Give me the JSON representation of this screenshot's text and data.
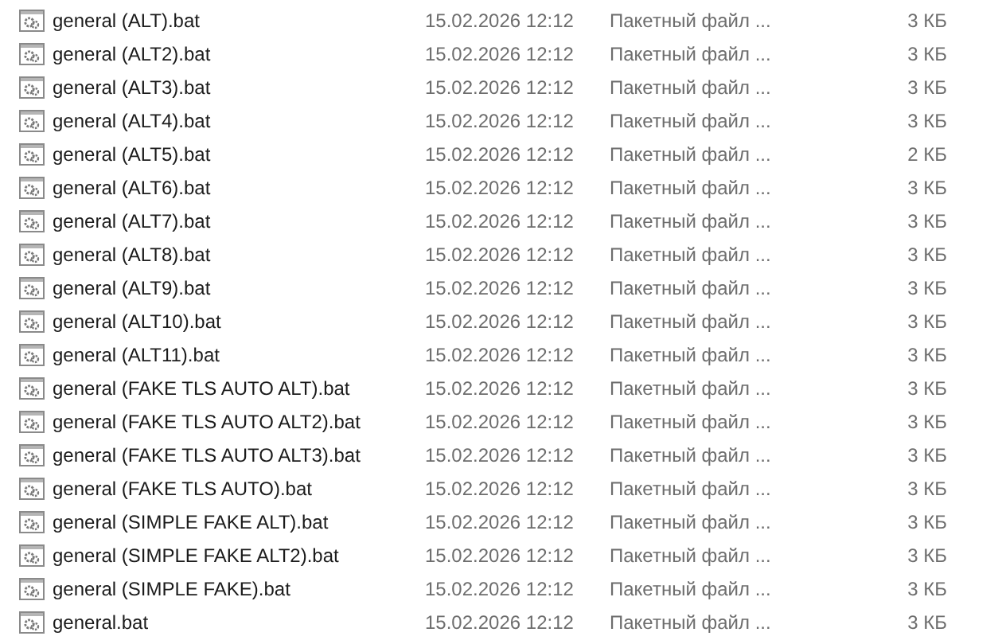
{
  "files": [
    {
      "name": "general (ALT).bat",
      "modified": "15.02.2026 12:12",
      "type": "Пакетный файл ...",
      "size": "3 КБ"
    },
    {
      "name": "general (ALT2).bat",
      "modified": "15.02.2026 12:12",
      "type": "Пакетный файл ...",
      "size": "3 КБ"
    },
    {
      "name": "general (ALT3).bat",
      "modified": "15.02.2026 12:12",
      "type": "Пакетный файл ...",
      "size": "3 КБ"
    },
    {
      "name": "general (ALT4).bat",
      "modified": "15.02.2026 12:12",
      "type": "Пакетный файл ...",
      "size": "3 КБ"
    },
    {
      "name": "general (ALT5).bat",
      "modified": "15.02.2026 12:12",
      "type": "Пакетный файл ...",
      "size": "2 КБ"
    },
    {
      "name": "general (ALT6).bat",
      "modified": "15.02.2026 12:12",
      "type": "Пакетный файл ...",
      "size": "3 КБ"
    },
    {
      "name": "general (ALT7).bat",
      "modified": "15.02.2026 12:12",
      "type": "Пакетный файл ...",
      "size": "3 КБ"
    },
    {
      "name": "general (ALT8).bat",
      "modified": "15.02.2026 12:12",
      "type": "Пакетный файл ...",
      "size": "3 КБ"
    },
    {
      "name": "general (ALT9).bat",
      "modified": "15.02.2026 12:12",
      "type": "Пакетный файл ...",
      "size": "3 КБ"
    },
    {
      "name": "general (ALT10).bat",
      "modified": "15.02.2026 12:12",
      "type": "Пакетный файл ...",
      "size": "3 КБ"
    },
    {
      "name": "general (ALT11).bat",
      "modified": "15.02.2026 12:12",
      "type": "Пакетный файл ...",
      "size": "3 КБ"
    },
    {
      "name": "general (FAKE TLS AUTO ALT).bat",
      "modified": "15.02.2026 12:12",
      "type": "Пакетный файл ...",
      "size": "3 КБ"
    },
    {
      "name": "general (FAKE TLS AUTO ALT2).bat",
      "modified": "15.02.2026 12:12",
      "type": "Пакетный файл ...",
      "size": "3 КБ"
    },
    {
      "name": "general (FAKE TLS AUTO ALT3).bat",
      "modified": "15.02.2026 12:12",
      "type": "Пакетный файл ...",
      "size": "3 КБ"
    },
    {
      "name": "general (FAKE TLS AUTO).bat",
      "modified": "15.02.2026 12:12",
      "type": "Пакетный файл ...",
      "size": "3 КБ"
    },
    {
      "name": "general (SIMPLE FAKE ALT).bat",
      "modified": "15.02.2026 12:12",
      "type": "Пакетный файл ...",
      "size": "3 КБ"
    },
    {
      "name": "general (SIMPLE FAKE ALT2).bat",
      "modified": "15.02.2026 12:12",
      "type": "Пакетный файл ...",
      "size": "3 КБ"
    },
    {
      "name": "general (SIMPLE FAKE).bat",
      "modified": "15.02.2026 12:12",
      "type": "Пакетный файл ...",
      "size": "3 КБ"
    },
    {
      "name": "general.bat",
      "modified": "15.02.2026 12:12",
      "type": "Пакетный файл ...",
      "size": "3 КБ"
    }
  ]
}
